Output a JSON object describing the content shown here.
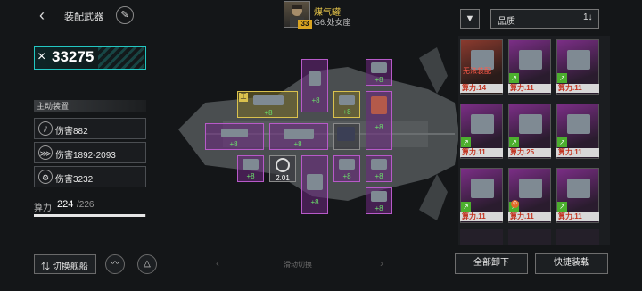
{
  "header": {
    "title": "装配武器",
    "pilot_name": "煤气罐",
    "pilot_rank": "G6.处女座",
    "pilot_level": "33",
    "sort_label": "品质"
  },
  "icons": {
    "back": "back-arrow-icon",
    "edit": "brush-icon",
    "filter": "filter-icon",
    "sort": "sort-toggle-icon"
  },
  "power": {
    "icon": "×",
    "value": "33275"
  },
  "active": {
    "section_label": "主动装置",
    "stats": [
      {
        "icon": "slash-icon",
        "text": "伤害882"
      },
      {
        "icon": "claw-icon",
        "text": "伤害1892-2093"
      },
      {
        "icon": "gear-icon",
        "text": "伤害3232"
      }
    ]
  },
  "capacity": {
    "label": "算力",
    "used": "224",
    "total": "/226",
    "ratio": 0.991
  },
  "slots": {
    "plus_labels": [
      "+8",
      "+8",
      "+8",
      "+8",
      "+8",
      "+8",
      "+8",
      "+8",
      "+8",
      "+8",
      "+8",
      "+8"
    ],
    "special_value": "2.01",
    "gold_marker": "王"
  },
  "footer": {
    "switch_label": "切换舰船",
    "hint": "滑动切换",
    "unload_all": "全部卸下",
    "quick_equip": "快捷装载"
  },
  "inventory": {
    "warn_text": "无法装配",
    "cards": [
      {
        "label": "算力.14",
        "red": true
      },
      {
        "label": "算力.11"
      },
      {
        "label": "算力.11"
      },
      {
        "label": "算力.11"
      },
      {
        "label": "算力.25"
      },
      {
        "label": "算力.11"
      },
      {
        "label": "算力.11"
      },
      {
        "label": "算力.11"
      },
      {
        "label": "算力.11"
      }
    ]
  },
  "colors": {
    "accent": "#23c7c2",
    "purple": "#b75ac8",
    "gold": "#d9c14d",
    "power_red": "#c2321f"
  }
}
